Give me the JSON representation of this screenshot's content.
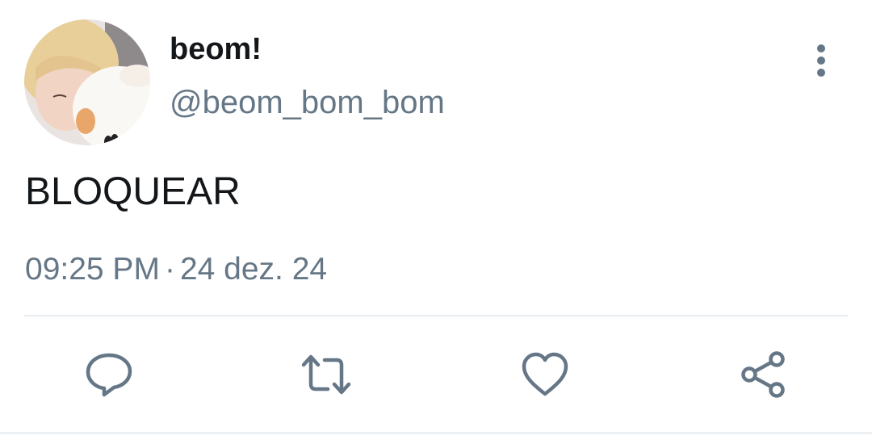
{
  "tweet": {
    "display_name": "beom!",
    "handle": "@beom_bom_bom",
    "text": "BLOQUEAR",
    "time": "09:25 PM",
    "separator": "·",
    "date": "24 dez. 24"
  },
  "icons": {
    "more": "more-vertical-icon",
    "reply": "reply-icon",
    "retweet": "retweet-icon",
    "like": "heart-icon",
    "share": "share-icon"
  },
  "colors": {
    "primary_text": "#14171a",
    "secondary_text": "#657786",
    "divider": "#e6ecf0"
  }
}
